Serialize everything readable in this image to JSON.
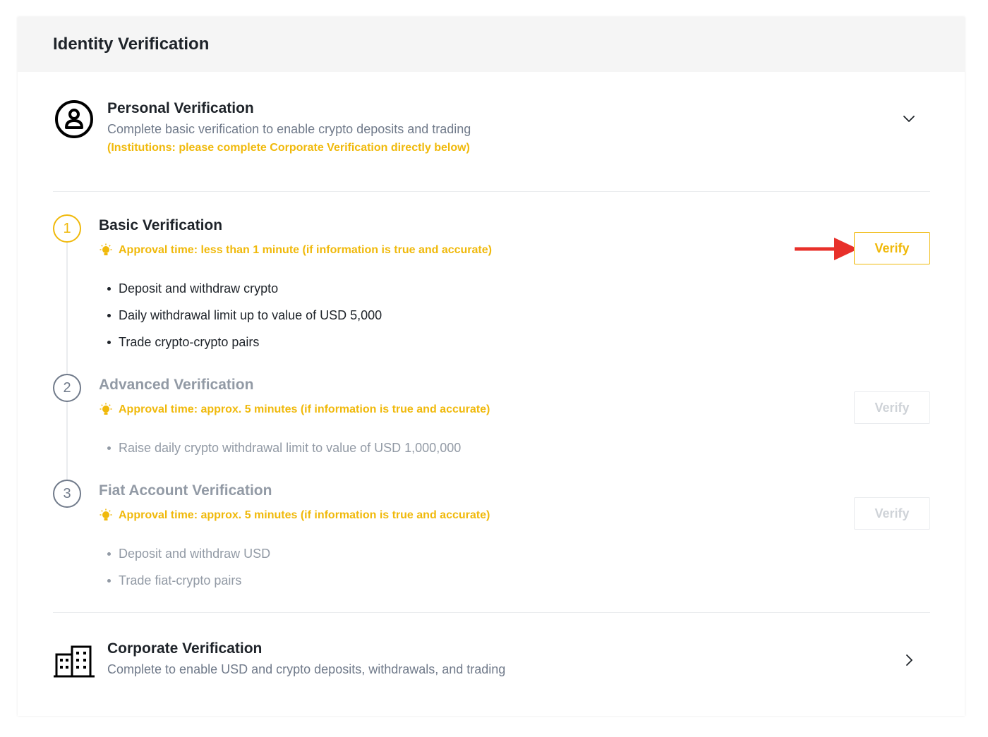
{
  "card": {
    "title": "Identity Verification"
  },
  "personal": {
    "icon": "user-circle-icon",
    "title": "Personal Verification",
    "subtitle": "Complete basic verification to enable crypto deposits and trading",
    "note": "(Institutions: please complete Corporate Verification directly below)"
  },
  "steps": [
    {
      "number": "1",
      "title": "Basic Verification",
      "approval": "Approval time: less than 1 minute (if information is true and accurate)",
      "bullets": [
        "Deposit and withdraw crypto",
        "Daily withdrawal limit up to value of USD 5,000",
        "Trade crypto-crypto pairs"
      ],
      "button": "Verify",
      "state": "active"
    },
    {
      "number": "2",
      "title": "Advanced Verification",
      "approval": "Approval time: approx. 5 minutes (if information is true and accurate)",
      "bullets": [
        "Raise daily crypto withdrawal limit to value of USD 1,000,000"
      ],
      "button": "Verify",
      "state": "disabled"
    },
    {
      "number": "3",
      "title": "Fiat Account Verification",
      "approval": "Approval time: approx. 5 minutes (if information is true and accurate)",
      "bullets": [
        "Deposit and withdraw USD",
        "Trade fiat-crypto pairs"
      ],
      "button": "Verify",
      "state": "disabled"
    }
  ],
  "corporate": {
    "icon": "building-icon",
    "title": "Corporate Verification",
    "subtitle": "Complete to enable USD and crypto deposits, withdrawals, and trading"
  },
  "colors": {
    "accent": "#f0b90b",
    "annotation_arrow": "#e8302a",
    "text_primary": "#1e2329",
    "text_secondary": "#707a8a",
    "text_muted": "#929aa5"
  }
}
